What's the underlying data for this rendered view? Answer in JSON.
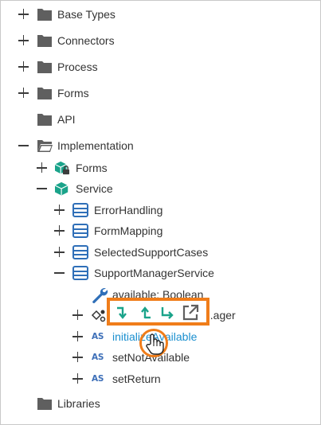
{
  "tree": {
    "base_types": "Base Types",
    "connectors": "Connectors",
    "process": "Process",
    "forms": "Forms",
    "api": "API",
    "implementation": "Implementation",
    "impl_forms": "Forms",
    "service": "Service",
    "error_handling": "ErrorHandling",
    "form_mapping": "FormMapping",
    "selected_support_cases": "SelectedSupportCases",
    "support_manager_service": "SupportManagerService",
    "available_field": "available: Boolean",
    "manager_item": "...ager",
    "initialize_available": "initializeAvailable",
    "set_not_available": "setNotAvailable",
    "set_return": "setReturn",
    "libraries": "Libraries"
  },
  "badges": {
    "script": "AS"
  },
  "toolbar": {
    "buttons": [
      "step-into",
      "step-out",
      "step-over",
      "open-in-new"
    ]
  },
  "colors": {
    "folder": "#5f5f5f",
    "teal": "#1aa38a",
    "blue_class": "#2f6fb8",
    "accent_orange": "#f07d1a",
    "link": "#1a8fcf"
  }
}
